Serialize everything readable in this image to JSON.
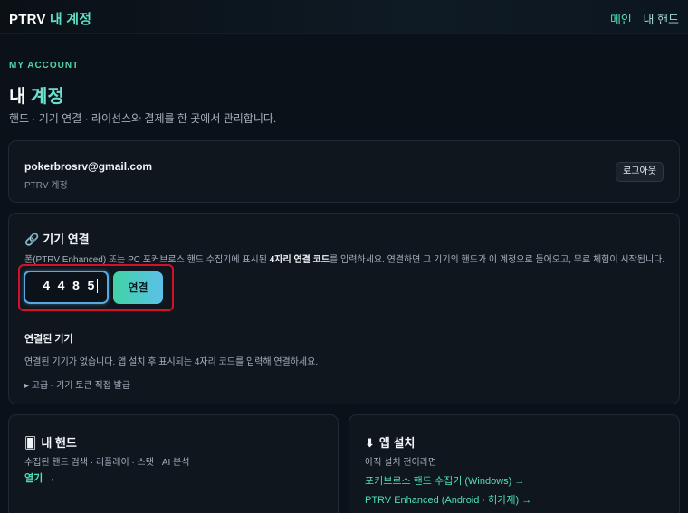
{
  "header": {
    "brand_main": "PTRV",
    "brand_accent": "내 계정",
    "nav": [
      {
        "label": "메인"
      },
      {
        "label": "내 핸드"
      }
    ]
  },
  "page": {
    "eyebrow": "MY ACCOUNT",
    "title_plain": "내",
    "title_accent": "계정",
    "subtitle": "핸드 · 기기 연결 · 라이선스와 결제를 한 곳에서 관리합니다."
  },
  "account": {
    "email": "pokerbrosrv@gmail.com",
    "account_type": "PTRV 계정",
    "logout_label": "로그아웃"
  },
  "device": {
    "icon": "link-icon",
    "title": "기기 연결",
    "instruction_before": "폰(PTRV Enhanced) 또는 PC 포커브로스 핸드 수집기에 표시된 ",
    "instruction_bold": "4자리 연결 코드",
    "instruction_after": "를 입력하세요. 연결하면 그 기기의 핸드가 이 계정으로 들어오고, 무료 체험이 시작됩니다.",
    "code_value": "4485",
    "connect_label": "연결",
    "connected_title": "연결된 기기",
    "no_device_text": "연결된 기기가 없습니다. 앱 설치 후 표시되는 4자리 코드를 입력해 연결하세요.",
    "advanced_label": "▸ 고급 - 기기 토큰 직접 발급"
  },
  "hands_card": {
    "icon": "playing-card-icon",
    "title": "내 핸드",
    "subtitle": "수집된 핸드 검색 · 리플레이 · 스탯 · AI 분석",
    "open_link": "열기 →"
  },
  "install_card": {
    "icon": "download-arrow-icon",
    "title": "앱 설치",
    "subtitle": "아직 설치 전이라면",
    "links": [
      {
        "label": "포커브로스 핸드 수집기 (Windows) →"
      },
      {
        "label": "PTRV Enhanced (Android · 허가제) →"
      }
    ]
  },
  "colors": {
    "background": "#0b1118",
    "accent_green": "#4fe0b5",
    "highlight_red": "#d6102b",
    "input_border": "#5aa8e0"
  }
}
